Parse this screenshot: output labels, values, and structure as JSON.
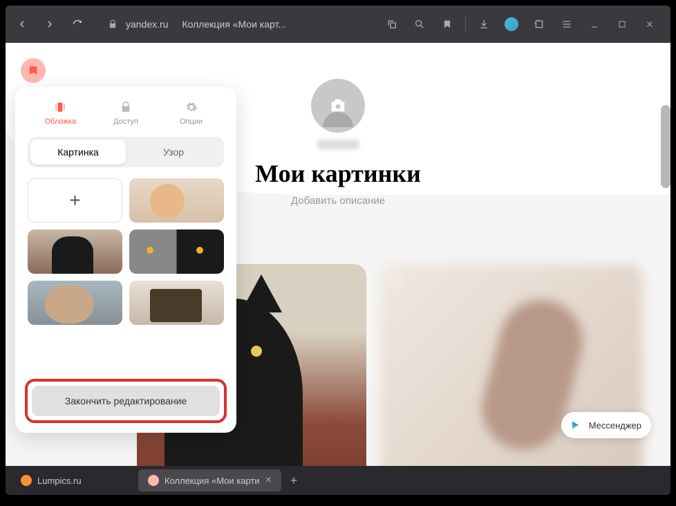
{
  "browser": {
    "url": "yandex.ru",
    "page_title": "Коллекция «Мои карт..."
  },
  "editor_panel": {
    "tabs": {
      "cover": "Обложка",
      "access": "Доступ",
      "options": "Опции"
    },
    "subtabs": {
      "picture": "Картинка",
      "pattern": "Узор"
    },
    "finish_button": "Закончить редактирование"
  },
  "profile": {
    "collection_title": "Мои картинки",
    "add_description": "Добавить описание"
  },
  "messenger": {
    "label": "Мессенджер"
  },
  "taskbar": {
    "tab1": "Lumpics.ru",
    "tab2": "Коллекция «Мои карти"
  }
}
